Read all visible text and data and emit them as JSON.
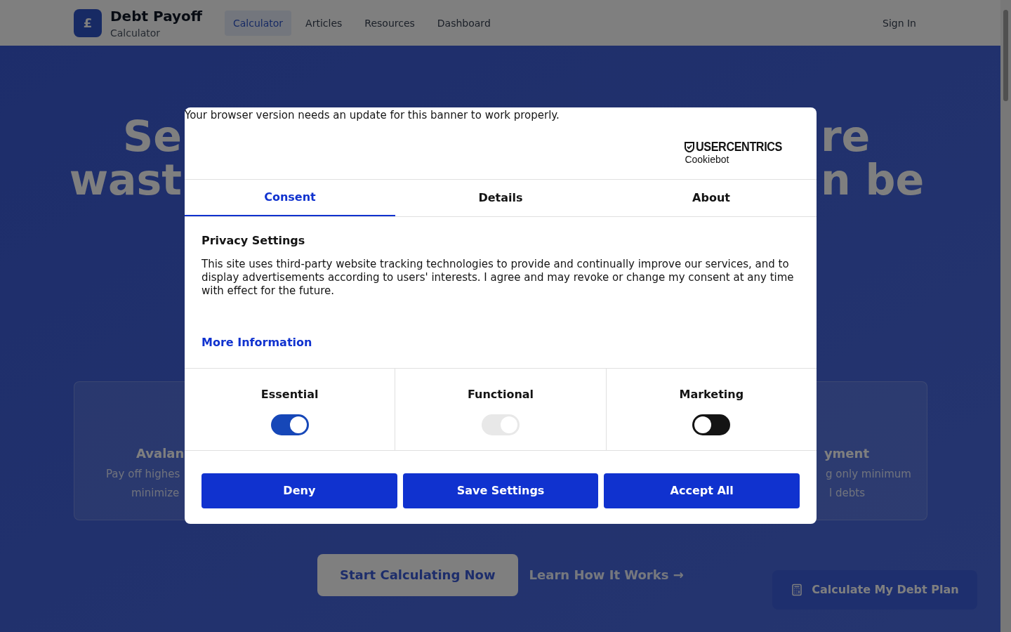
{
  "navbar": {
    "logo": "£",
    "brand": "Debt Payoff",
    "subtitle": "Calculator",
    "links": [
      {
        "label": "Calculator",
        "selected": true
      },
      {
        "label": "Articles",
        "selected": false
      },
      {
        "label": "Resources",
        "selected": false
      },
      {
        "label": "Dashboard",
        "selected": false
      }
    ],
    "sign_in": "Sign In"
  },
  "hero": {
    "heading_lines": [
      {
        "left": "Se",
        "right": "re"
      },
      {
        "left": "wast",
        "right": "n be"
      }
    ],
    "left_card": {
      "title": "Avalan",
      "lines": [
        "Pay off highes",
        "minimize"
      ]
    },
    "right_card": {
      "title": "yment",
      "lines": [
        "g only minimum",
        "l debts"
      ]
    },
    "primary_button": "Start Calculating Now",
    "secondary_link": "Learn How It Works →"
  },
  "floating_button": "Calculate My Debt Plan",
  "consent_dialog": {
    "notice": "Your browser version needs an update for this banner to work properly.",
    "logo_brand": "USERCENTRICS",
    "logo_product": "Cookiebot",
    "tabs": [
      {
        "label": "Consent",
        "selected": true
      },
      {
        "label": "Details",
        "selected": false
      },
      {
        "label": "About",
        "selected": false
      }
    ],
    "title": "Privacy Settings",
    "body": "This site uses third-party website tracking technologies to provide and continually improve our services, and to display advertisements according to users' interests. I agree and may revoke or change my consent at any time with effect for the future.",
    "more_info": "More Information",
    "categories": [
      {
        "label": "Essential",
        "checked": true,
        "disabled": false
      },
      {
        "label": "Functional",
        "checked": true,
        "disabled": true
      },
      {
        "label": "Marketing",
        "checked": false,
        "disabled": false
      }
    ],
    "buttons": [
      "Deny",
      "Save Settings",
      "Accept All"
    ]
  }
}
